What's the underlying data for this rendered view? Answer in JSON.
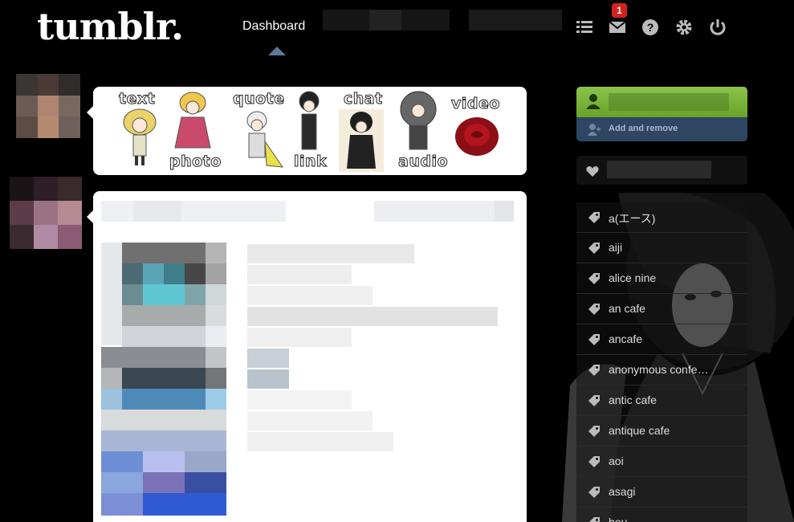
{
  "header": {
    "logo": "tumblr.",
    "nav_dashboard": "Dashboard",
    "inbox_count": "1"
  },
  "post_types": {
    "items": [
      {
        "label": "text"
      },
      {
        "label": "photo"
      },
      {
        "label": "quote"
      },
      {
        "label": "link"
      },
      {
        "label": "chat"
      },
      {
        "label": "audio"
      },
      {
        "label": "video"
      }
    ]
  },
  "sidebar": {
    "add_remove_label": "Add and remove",
    "tags": [
      "a(エース)",
      "aiji",
      "alice nine",
      "an cafe",
      "ancafe",
      "anonymous confe…",
      "antic cafe",
      "antique cafe",
      "aoi",
      "asagi",
      "bou"
    ]
  },
  "colors": {
    "background": "#000000",
    "account_green": "#7ab53a",
    "account_blue": "#2e4661",
    "badge_red": "#d6221c",
    "caret": "#5f7a96"
  },
  "icons": [
    "list-icon",
    "mail-icon",
    "help-icon",
    "gear-icon",
    "power-icon",
    "user-icon",
    "add-user-icon",
    "heart-icon",
    "tag-icon"
  ]
}
